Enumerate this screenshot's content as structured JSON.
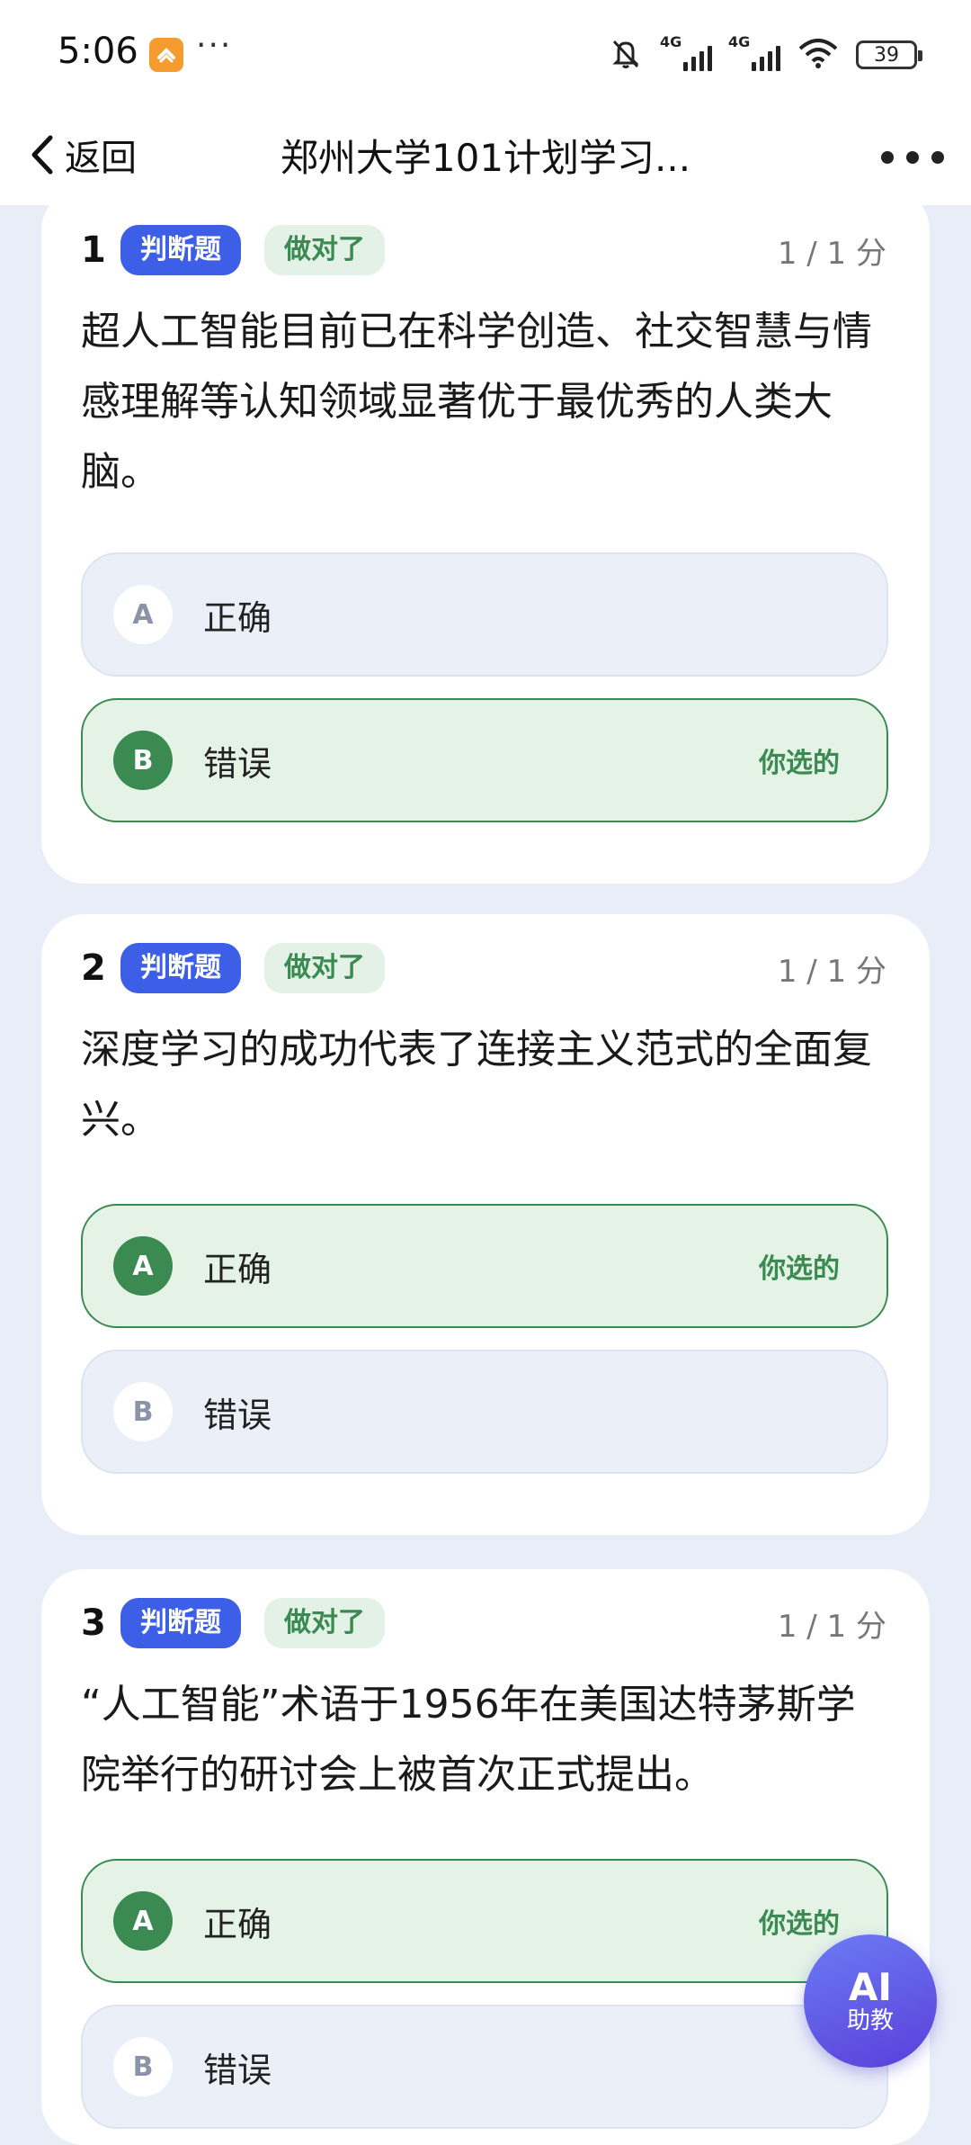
{
  "status_bar": {
    "time": "5:06",
    "dots": "···",
    "signal1_label": "4G",
    "signal2_label": "4G",
    "battery": "39"
  },
  "nav": {
    "back_label": "返回",
    "title": "郑州大学101计划学习..."
  },
  "questions": [
    {
      "num": "1",
      "type": "判断题",
      "result": "做对了",
      "score": "1 / 1 分",
      "text": "超人工智能目前已在科学创造、社交智慧与情感理解等认知领域显著优于最优秀的人类大脑。",
      "options": [
        {
          "letter": "A",
          "text": "正确",
          "chosen": ""
        },
        {
          "letter": "B",
          "text": "错误",
          "chosen": "你选的"
        }
      ]
    },
    {
      "num": "2",
      "type": "判断题",
      "result": "做对了",
      "score": "1 / 1 分",
      "text": "深度学习的成功代表了连接主义范式的全面复兴。",
      "options": [
        {
          "letter": "A",
          "text": "正确",
          "chosen": "你选的"
        },
        {
          "letter": "B",
          "text": "错误",
          "chosen": ""
        }
      ]
    },
    {
      "num": "3",
      "type": "判断题",
      "result": "做对了",
      "score": "1 / 1 分",
      "text": "“人工智能”术语于1956年在美国达特茅斯学院举行的研讨会上被首次正式提出。",
      "options": [
        {
          "letter": "A",
          "text": "正确",
          "chosen": "你选的"
        },
        {
          "letter": "B",
          "text": "错误",
          "chosen": ""
        }
      ]
    }
  ],
  "ai_button": {
    "big": "AI",
    "small": "助教"
  }
}
